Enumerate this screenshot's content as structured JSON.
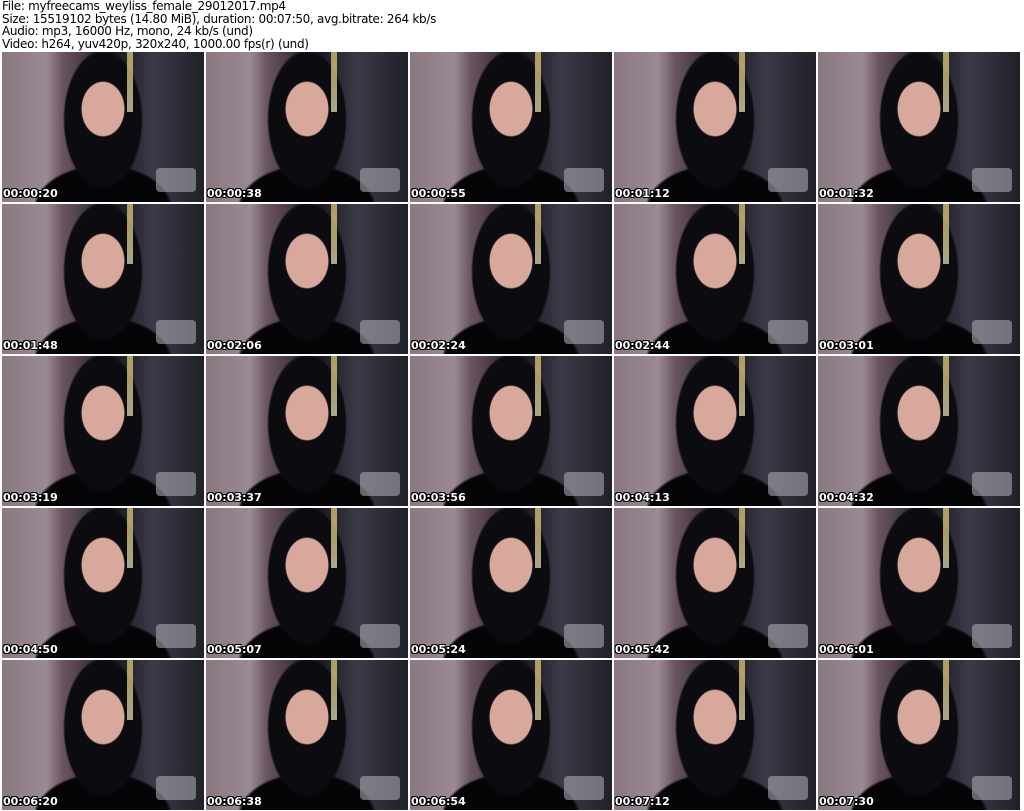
{
  "header": {
    "file": "File: myfreecams_weyliss_female_29012017.mp4",
    "size": "Size: 15519102 bytes (14.80 MiB), duration: 00:07:50, avg.bitrate: 264 kb/s",
    "audio": "Audio: mp3, 16000 Hz, mono, 24 kb/s (und)",
    "video": "Video: h264, yuv420p, 320x240, 1000.00 fps(r) (und)"
  },
  "thumbnails": [
    "00:00:20",
    "00:00:38",
    "00:00:55",
    "00:01:12",
    "00:01:32",
    "00:01:48",
    "00:02:06",
    "00:02:24",
    "00:02:44",
    "00:03:01",
    "00:03:19",
    "00:03:37",
    "00:03:56",
    "00:04:13",
    "00:04:32",
    "00:04:50",
    "00:05:07",
    "00:05:24",
    "00:05:42",
    "00:06:01",
    "00:06:20",
    "00:06:38",
    "00:06:54",
    "00:07:12",
    "00:07:30"
  ]
}
